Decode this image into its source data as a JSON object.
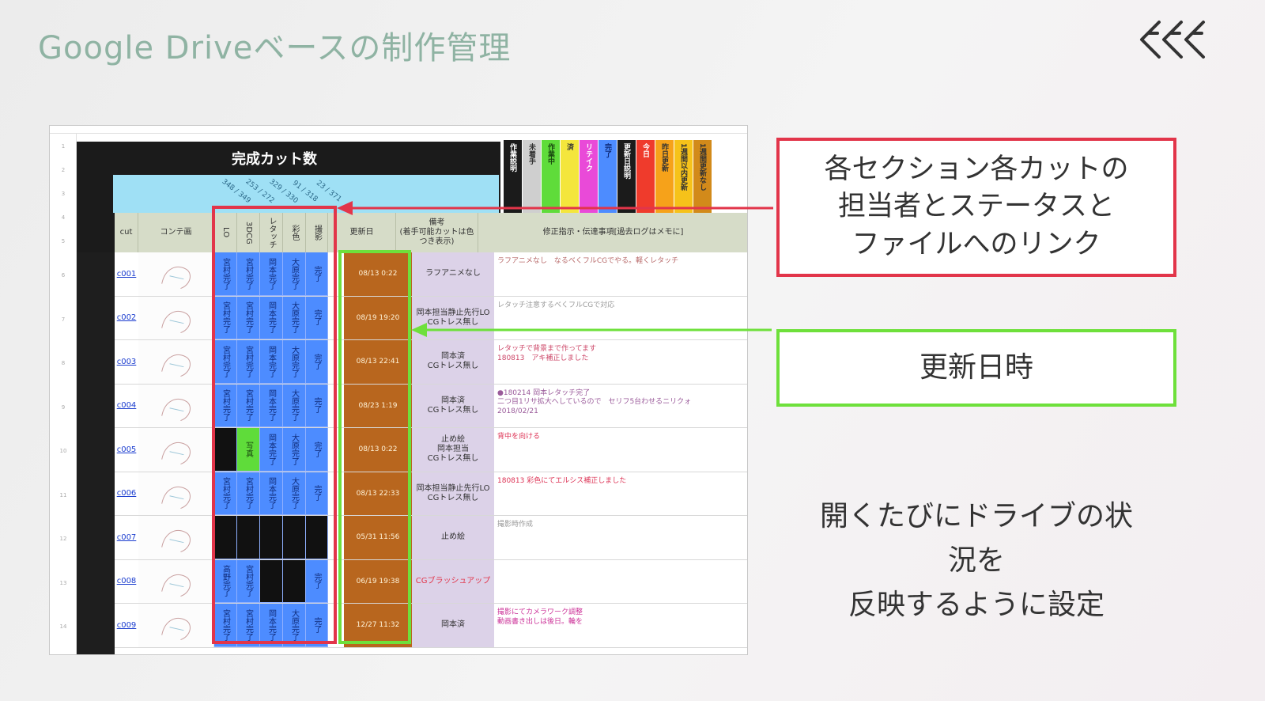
{
  "slide": {
    "title": "Google Driveベースの制作管理",
    "logo_icon": "fff-logo-icon"
  },
  "sheet": {
    "header_title": "完成カット数",
    "counts": [
      "348 / 349",
      "253 / 272",
      "329 / 330",
      "91 / 318",
      "23 / 371"
    ],
    "legend": [
      {
        "label": "作業説明",
        "color": "#1b1b1b",
        "text_color": "#ffffff"
      },
      {
        "label": "未着手",
        "color": "#cfcfcf",
        "text_color": "#333333"
      },
      {
        "label": "作業中",
        "color": "#5fdc3a",
        "text_color": "#1a4a10"
      },
      {
        "label": "済",
        "color": "#f4e63c",
        "text_color": "#333333"
      },
      {
        "label": "リテイク",
        "color": "#e94ad8",
        "text_color": "#ffffff"
      },
      {
        "label": "完了",
        "color": "#4d8cff",
        "text_color": "#0f2b7a"
      },
      {
        "label": "更新日説明",
        "color": "#1b1b1b",
        "text_color": "#ffffff"
      },
      {
        "label": "今日",
        "color": "#ef3b2c",
        "text_color": "#ffffff"
      },
      {
        "label": "昨日更新",
        "color": "#f6a21a",
        "text_color": "#333333"
      },
      {
        "label": "1週間以内更新",
        "color": "#f6c21a",
        "text_color": "#333333"
      },
      {
        "label": "1週間更新なし",
        "color": "#d28a1a",
        "text_color": "#333333"
      }
    ],
    "columns": {
      "cut": "cut",
      "storyboard": "コンテ画",
      "lo": "LO",
      "3dcg": "3DCG",
      "retouch": "レタッチ",
      "color": "彩色",
      "shoot": "撮影",
      "updated": "更新日",
      "note": "備考\n(着手可能カットは色つき表示)",
      "memo": "修正指示・伝達事項[過去ログはメモに]"
    },
    "rows": [
      {
        "cut": "c001",
        "status": [
          "宮村完了",
          "宮村完了",
          "岡本完了",
          "大原完了",
          "完了"
        ],
        "date": "08/13 0:22",
        "note": "ラフアニメなし",
        "memo": "ラフアニメなし　なるべくフルCGでやる。軽くレタッチ",
        "memo_color": "#b86a6a"
      },
      {
        "cut": "c002",
        "status": [
          "宮村完了",
          "宮村完了",
          "岡本完了",
          "大原完了",
          "完了"
        ],
        "date": "08/19 19:20",
        "note": "岡本担当静止先行LO\nCGトレス無し",
        "memo": "レタッチ注意するべくフルCGで対応",
        "memo_color": "#999999"
      },
      {
        "cut": "c003",
        "status": [
          "宮村完了",
          "宮村完了",
          "岡本完了",
          "大原完了",
          "完了"
        ],
        "date": "08/13 22:41",
        "note": "岡本済\nCGトレス無し",
        "memo": "レタッチで背景まで作ってます\n180813　アキ補正しました",
        "memo_color": "#cc4466"
      },
      {
        "cut": "c004",
        "status": [
          "宮村完了",
          "宮村完了",
          "岡本完了",
          "大原完了",
          "完了"
        ],
        "date": "08/23 1:19",
        "note": "岡本済\nCGトレス無し",
        "memo": "●180214 岡本レタッチ完了\n二つ目1リサ拡大へしているので　セリフ5台わせるニリクォ\n2018/02/21",
        "memo_color": "#9a5a9a"
      },
      {
        "cut": "c005",
        "status": [
          "",
          "写真",
          "岡本完了",
          "大原完了",
          "完了"
        ],
        "date": "08/13 0:22",
        "note": "止め絵\n岡本担当\nCGトレス無し",
        "memo": "背中を向ける",
        "memo_color": "#dd3355"
      },
      {
        "cut": "c006",
        "status": [
          "宮村完了",
          "宮村完了",
          "岡本完了",
          "大原完了",
          "完了"
        ],
        "date": "08/13 22:33",
        "note": "岡本担当静止先行LO\nCGトレス無し",
        "memo": "180813 彩色にてエルシス補正しました",
        "memo_color": "#dd3355"
      },
      {
        "cut": "c007",
        "status": [
          "",
          "",
          "",
          "",
          ""
        ],
        "date": "05/31 11:56",
        "note": "止め絵",
        "memo": "撮影時作成",
        "memo_color": "#999999"
      },
      {
        "cut": "c008",
        "status": [
          "高野完了",
          "宮村完了",
          "",
          "",
          "完了"
        ],
        "date": "06/19 19:38",
        "note": "CGブラッシュアップ",
        "memo": "",
        "memo_color": "#999999"
      },
      {
        "cut": "c009",
        "status": [
          "宮村完了",
          "宮村完了",
          "岡本完了",
          "大原完了",
          "完了"
        ],
        "date": "12/27 11:32",
        "note": "岡本済",
        "memo": "撮影にてカメラワーク調整\n動画書き出しは後日。輪を",
        "memo_color": "#cc3399"
      }
    ]
  },
  "callouts": {
    "red": "各セクション各カットの\n担当者とステータスと\nファイルへのリンク",
    "green": "更新日時",
    "bottom": "開くたびにドライブの状\n況を\n反映するように設定"
  },
  "colors": {
    "title": "#8fb3a3",
    "red_frame": "#e2354a",
    "green_frame": "#6ee03b",
    "done_blue": "#4d8cff",
    "date_orange": "#b8661e"
  }
}
